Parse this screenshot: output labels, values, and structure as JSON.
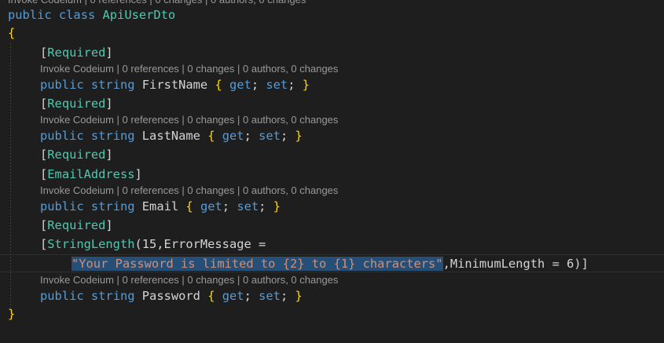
{
  "top_lens_partial": "Invoke Codeium | 0 references | 0 changes | 0 authors, 0 changes",
  "code": {
    "class_decl": {
      "public": "public",
      "class": "class",
      "name": "ApiUserDto"
    },
    "open_brace": "{",
    "close_brace": "}",
    "required_attr": "Required",
    "email_attr": "EmailAddress",
    "stringlength_attr": "StringLength",
    "stringlength_args_start": "(15,ErrorMessage =",
    "error_message_string": "\"Your Password is limited to {2} to {1} characters\"",
    "minimum_length": ",MinimumLength = 6)]",
    "props": [
      {
        "mod": "public",
        "type": "string",
        "name": "FirstName"
      },
      {
        "mod": "public",
        "type": "string",
        "name": "LastName"
      },
      {
        "mod": "public",
        "type": "string",
        "name": "Email"
      },
      {
        "mod": "public",
        "type": "string",
        "name": "Password"
      }
    ],
    "accessors": {
      "get": "get",
      "set": "set"
    }
  },
  "codelens": "Invoke Codeium | 0 references | 0 changes | 0 authors, 0 changes",
  "colors": {
    "background": "#1e1e1e",
    "keyword": "#569cd6",
    "type": "#4ec9b0",
    "string": "#ce9178",
    "bracket": "#ffd700",
    "selection": "#264f78"
  }
}
